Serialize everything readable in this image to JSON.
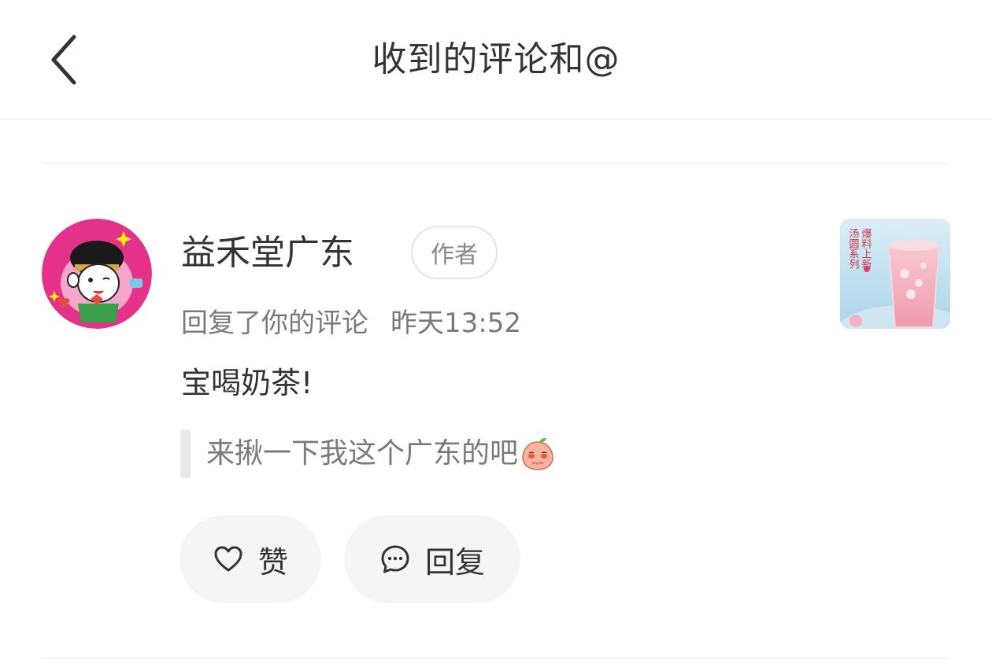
{
  "header": {
    "title": "收到的评论和@",
    "back_icon": "chevron-left-icon"
  },
  "notification": {
    "user_name": "益禾堂广东",
    "author_badge": "作者",
    "action_text": "回复了你的评论",
    "time": "昨天13:52",
    "comment": "宝喝奶茶!",
    "quoted_comment": "来揪一下我这个广东的吧",
    "quoted_emoji": "pleading-peach-emoji",
    "thumbnail_text": [
      "爆料上新",
      "汤圆系列"
    ],
    "like_label": "赞",
    "reply_label": "回复"
  },
  "colors": {
    "avatar_bg": "#e4328a",
    "badge_border": "#e6e6e6",
    "button_bg": "#f5f5f5",
    "muted_text": "#7a7a7a"
  }
}
